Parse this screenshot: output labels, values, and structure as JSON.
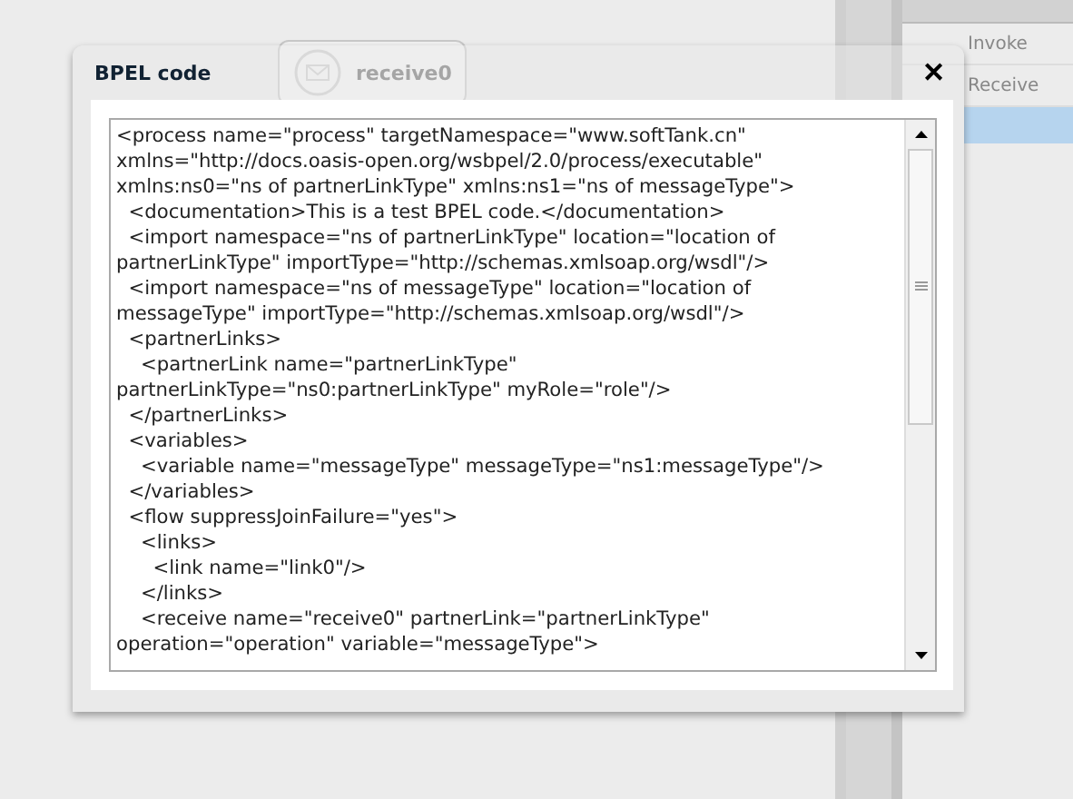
{
  "palette": {
    "items": [
      {
        "label": "Invoke"
      },
      {
        "label": "Receive"
      }
    ]
  },
  "canvas": {
    "nodes": [
      {
        "label": "receive0"
      }
    ]
  },
  "dialog": {
    "title": "BPEL code",
    "close": "✕",
    "code_lines": [
      "<process name=\"process\" targetNamespace=\"www.softTank.cn\"",
      "xmlns=\"http://docs.oasis-open.org/wsbpel/2.0/process/executable\"",
      "xmlns:ns0=\"ns of partnerLinkType\" xmlns:ns1=\"ns of messageType\">",
      "  <documentation>This is a test BPEL code.</documentation>",
      "  <import namespace=\"ns of partnerLinkType\" location=\"location of",
      "partnerLinkType\" importType=\"http://schemas.xmlsoap.org/wsdl\"/>",
      "  <import namespace=\"ns of messageType\" location=\"location of",
      "messageType\" importType=\"http://schemas.xmlsoap.org/wsdl\"/>",
      "  <partnerLinks>",
      "    <partnerLink name=\"partnerLinkType\"",
      "partnerLinkType=\"ns0:partnerLinkType\" myRole=\"role\"/>",
      "  </partnerLinks>",
      "  <variables>",
      "    <variable name=\"messageType\" messageType=\"ns1:messageType\"/>",
      "  </variables>",
      "  <flow suppressJoinFailure=\"yes\">",
      "    <links>",
      "      <link name=\"link0\"/>",
      "    </links>",
      "    <receive name=\"receive0\" partnerLink=\"partnerLinkType\"",
      "operation=\"operation\" variable=\"messageType\">"
    ]
  }
}
